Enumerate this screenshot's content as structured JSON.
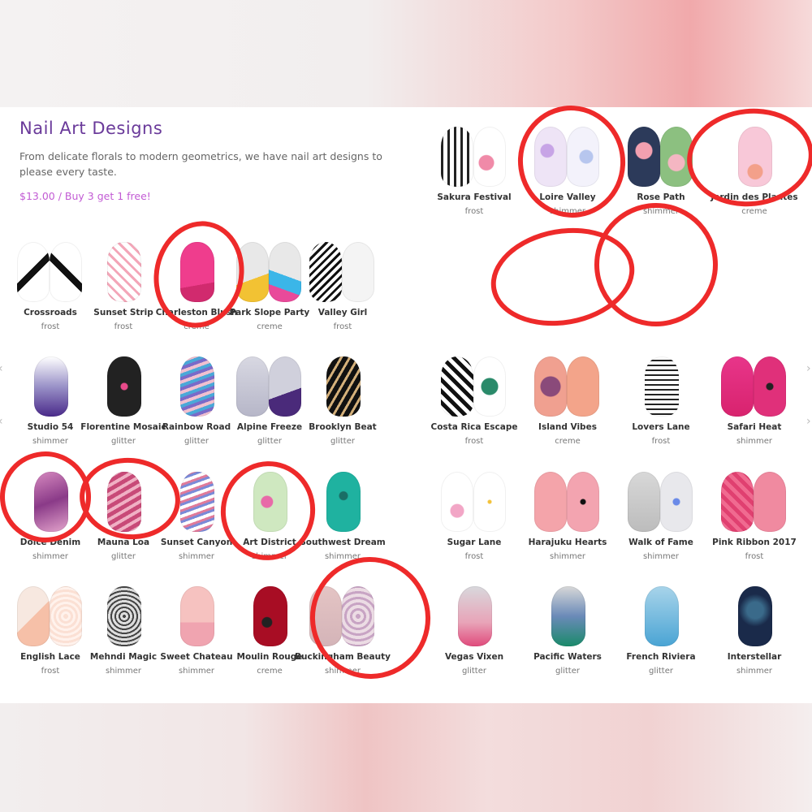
{
  "header": {
    "title": "Nail Art Designs",
    "description": "From delicate florals to modern geometrics, we have nail art designs to please every taste.",
    "price": "$13.00 / Buy 3 get 1 free!"
  },
  "colors": {
    "title": "#6a3a9a",
    "price": "#c25bd4",
    "annotation": "#ee2a2a"
  },
  "products": [
    {
      "name": "Sakura Festival",
      "type": "frost",
      "a": "repeating-linear-gradient(90deg,#222 0 3px,#fff 3px 8px)",
      "b": "radial-gradient(circle at 40% 60%,#f08aa8 0 9px,#fff 10px)"
    },
    {
      "name": "Loire Valley",
      "type": "shimmer",
      "a": "radial-gradient(circle at 40% 40%,#c7a4e6 0 8px,#eee4f6 9px)",
      "b": "radial-gradient(circle at 60% 50%,#b7c6ee 0 8px,#f3f2fb 9px)"
    },
    {
      "name": "Rose Path",
      "type": "shimmer",
      "a": "radial-gradient(circle at 50% 40%,#f3a0b0 0 10px,#2c3a5a 11px)",
      "b": "radial-gradient(circle at 50% 60%,#f4b6c2 0 10px,#8cc080 11px)"
    },
    {
      "name": "Jardin des Plantes",
      "type": "creme",
      "single": true,
      "a": "radial-gradient(circle at 50% 75%,#f3a08a 0 9px,#f8c8d8 10px)"
    },
    {
      "name": "Crossroads",
      "type": "frost",
      "a": "linear-gradient(135deg,#fff 45%,#111 45% 55%,#fff 55%)",
      "b": "linear-gradient(45deg,#fff 45%,#111 45% 55%,#fff 55%)"
    },
    {
      "name": "Sunset Strip",
      "type": "frost",
      "single": true,
      "a": "repeating-linear-gradient(45deg,#fff 0 6px,#f3a6b8 6px 9px)"
    },
    {
      "name": "Charleston Blush",
      "type": "creme",
      "single": true,
      "a": "linear-gradient(170deg,#ef3d8d 70%,#d12a6e 70%)"
    },
    {
      "name": "Park Slope Party",
      "type": "creme",
      "a": "linear-gradient(160deg,#e8e8e8 60%,#f2c233 60%)",
      "b": "linear-gradient(200deg,#e8e8e8 55%,#3bb6e8 55% 75%,#e94a9a 75%)"
    },
    {
      "name": "Valley Girl",
      "type": "frost",
      "a": "repeating-linear-gradient(135deg,#111 0 3px,#fff 3px 7px)",
      "b": "#f4f4f4"
    },
    {
      "name": "Studio 54",
      "type": "shimmer",
      "single": true,
      "a": "linear-gradient(180deg,#fff 0%,#9a92c8 50%,#4a2a8a 100%)"
    },
    {
      "name": "Florentine Mosaic",
      "type": "glitter",
      "single": true,
      "a": "radial-gradient(circle,#e84a8a 0 4px,#222 5px)"
    },
    {
      "name": "Rainbow Road",
      "type": "glitter",
      "single": true,
      "a": "repeating-linear-gradient(160deg,#7a6ac8 0 4px,#f0c0d0 4px 8px,#4aa8d8 8px 12px)"
    },
    {
      "name": "Alpine Freeze",
      "type": "glitter",
      "a": "linear-gradient(180deg,#d8d8e2,#b6b6c8)",
      "b": "linear-gradient(160deg,#d0d0dc 60%,#4a2a7a 60%)"
    },
    {
      "name": "Brooklyn Beat",
      "type": "glitter",
      "single": true,
      "a": "repeating-linear-gradient(120deg,#111 0 6px,#d4b07a 6px 9px)"
    },
    {
      "name": "Costa Rica Escape",
      "type": "frost",
      "a": "repeating-linear-gradient(45deg,#111 0 5px,#fff 5px 10px)",
      "b": "radial-gradient(circle at 50% 50%,#2a8a6a 0 10px,#fff 11px)"
    },
    {
      "name": "Island Vibes",
      "type": "creme",
      "a": "radial-gradient(circle at 50% 50%,#8a4a7a 0 12px,#f0a090 13px)",
      "b": "#f3a48a"
    },
    {
      "name": "Lovers Lane",
      "type": "frost",
      "single": true,
      "a": "repeating-linear-gradient(180deg,#fff 0 4px,#222 4px 6px)"
    },
    {
      "name": "Safari Heat",
      "type": "shimmer",
      "a": "linear-gradient(180deg,#e8358a,#d8236e)",
      "b": "radial-gradient(circle,#222 0 4px,#e0307a 5px)"
    },
    {
      "name": "Dolce Denim",
      "type": "shimmer",
      "single": true,
      "a": "linear-gradient(160deg,#d78ac0,#8a3a88,#e4a4cc)"
    },
    {
      "name": "Mauna Loa",
      "type": "glitter",
      "single": true,
      "a": "repeating-linear-gradient(150deg,#c84a78 0 5px,#f0b0c4 5px 9px)"
    },
    {
      "name": "Sunset Canyon",
      "type": "shimmer",
      "single": true,
      "a": "repeating-linear-gradient(160deg,#fff 0 4px,#e07a9a 4px 7px,#7a8ad8 7px 10px)"
    },
    {
      "name": "Art District",
      "type": "shimmer",
      "single": true,
      "a": "radial-gradient(circle at 40% 50%,#e86aa8 0 7px,#cfe8c0 8px)"
    },
    {
      "name": "Southwest Dream",
      "type": "shimmer",
      "single": true,
      "a": "radial-gradient(circle at 50% 40%,#1a6e66 0 5px,#1fb2a0 6px)"
    },
    {
      "name": "Sugar Lane",
      "type": "frost",
      "a": "radial-gradient(circle at 50% 65%,#f2a6c6 0 8px,#fff 9px)",
      "b": "radial-gradient(circle,#f3c23a 0 2px,#fff 3px)"
    },
    {
      "name": "Harajuku Hearts",
      "type": "shimmer",
      "a": "#f4a4aa",
      "b": "radial-gradient(circle,#111 0 3px,#f3a4b0 4px)"
    },
    {
      "name": "Walk of Fame",
      "type": "shimmer",
      "a": "linear-gradient(180deg,#d8d8d8,#bcbcbc)",
      "b": "radial-gradient(circle,#6a8ae8 0 4px,#e8e8ec 5px)"
    },
    {
      "name": "Pink Ribbon 2017",
      "type": "frost",
      "a": "repeating-linear-gradient(45deg,#e04070 0 5px,#f06a90 5px 10px)",
      "b": "#f08aa0"
    },
    {
      "name": "English Lace",
      "type": "frost",
      "a": "linear-gradient(135deg,#f7e8e0 50%,#f6c0a8 50%)",
      "b": "repeating-radial-gradient(circle,#fbe0d4 0 3px,#fff2ec 3px 6px)"
    },
    {
      "name": "Mehndi Magic",
      "type": "shimmer",
      "single": true,
      "a": "repeating-radial-gradient(circle,#444 0 2px,#ddd 2px 5px)"
    },
    {
      "name": "Sweet Chateau",
      "type": "shimmer",
      "single": true,
      "a": "linear-gradient(180deg,#f6c2c0 60%,#f0a4b0 60%)"
    },
    {
      "name": "Moulin Rouge",
      "type": "creme",
      "single": true,
      "a": "radial-gradient(circle at 40% 60%,#222 0 6px,#a80d24 7px)"
    },
    {
      "name": "Buckingham Beauty",
      "type": "shimmer",
      "a": "linear-gradient(180deg,#e4c4c4,#d4b4b8)",
      "b": "repeating-radial-gradient(circle,#c8a4c4 0 3px,#ecdce4 3px 7px)"
    },
    {
      "name": "Vegas Vixen",
      "type": "glitter",
      "single": true,
      "a": "linear-gradient(180deg,#d8d8dc 0%,#e8a4b8 60%,#e04a7c 100%)"
    },
    {
      "name": "Pacific Waters",
      "type": "glitter",
      "single": true,
      "a": "linear-gradient(180deg,#d8d8d8 0%,#6a8ab8 50%,#1a8a6a 100%)"
    },
    {
      "name": "French Riviera",
      "type": "glitter",
      "single": true,
      "a": "linear-gradient(180deg,#a8d4ea,#4aa4d4)"
    },
    {
      "name": "Interstellar",
      "type": "shimmer",
      "single": true,
      "a": "radial-gradient(circle at 50% 40%,#3a6a8a 0 10px,#1a2a4a 20px)"
    }
  ]
}
